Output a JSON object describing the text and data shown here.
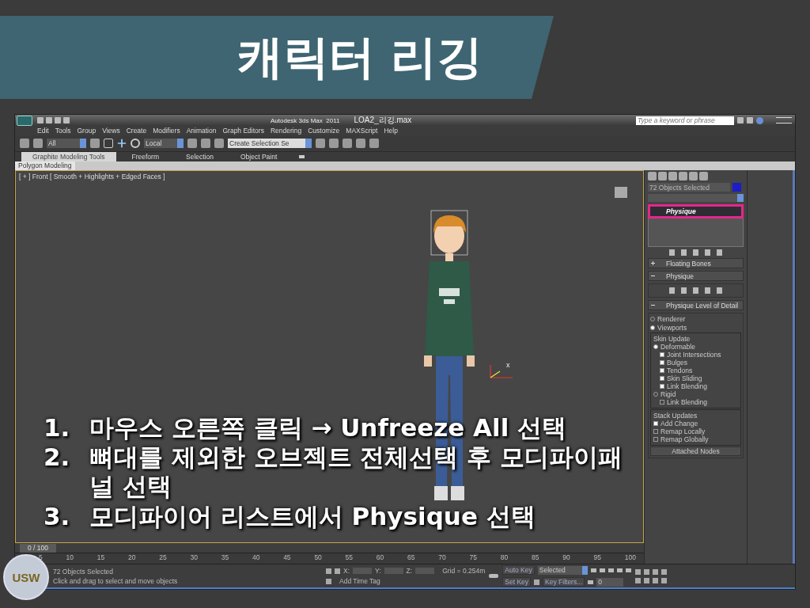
{
  "slide": {
    "title": "캐릭터 리깅"
  },
  "app": {
    "title": "Autodesk 3ds Max  2011",
    "file": "LOA2_리깅.max",
    "search": {
      "placeholder": "Type a keyword or phrase"
    },
    "menu": [
      "Edit",
      "Tools",
      "Group",
      "Views",
      "Create",
      "Modifiers",
      "Animation",
      "Graph Editors",
      "Rendering",
      "Customize",
      "MAXScript",
      "Help"
    ],
    "toolbar": {
      "selection_filter": "All",
      "reference_coordinate": "Local",
      "named_selection": "Create Selection Se"
    },
    "ribbon_tabs": [
      {
        "label": "Graphite Modeling Tools",
        "selected": true
      },
      {
        "label": "Freeform",
        "selected": false
      },
      {
        "label": "Selection",
        "selected": false
      },
      {
        "label": "Object Paint",
        "selected": false
      }
    ],
    "ribbon_panel": "Polygon Modeling",
    "viewport": {
      "label": "[ + ] Front [ Smooth + Highlights + Edged Faces ]",
      "axis_label": "x"
    },
    "command_panel": {
      "object_name": "72 Objects Selected",
      "modifier_stack": [
        {
          "label": "Physique",
          "selected": true,
          "highlighted": true
        }
      ],
      "rollouts": [
        {
          "title": "Floating Bones",
          "expanded": false
        },
        {
          "title": "Physique",
          "expanded": true
        },
        {
          "title": "Physique Level of Detail",
          "expanded": true
        }
      ],
      "modes": [
        {
          "label": "Renderer",
          "selected": false
        },
        {
          "label": "Viewports",
          "selected": true
        }
      ],
      "skin_update": {
        "title": "Skin Update",
        "options": [
          {
            "kind": "radio",
            "label": "Deformable",
            "selected": true
          },
          {
            "kind": "check",
            "label": "Joint Intersections",
            "checked": true
          },
          {
            "kind": "check",
            "label": "Bulges",
            "checked": true
          },
          {
            "kind": "check",
            "label": "Tendons",
            "checked": true
          },
          {
            "kind": "check",
            "label": "Skin Sliding",
            "checked": true
          },
          {
            "kind": "check",
            "label": "Link Blending",
            "checked": true
          },
          {
            "kind": "radio",
            "label": "Rigid",
            "selected": false
          },
          {
            "kind": "check",
            "label": "Link Blending",
            "checked": false
          }
        ]
      },
      "stack_updates": {
        "title": "Stack Updates",
        "options": [
          {
            "label": "Add Change",
            "checked": true
          },
          {
            "label": "Remap Locally",
            "checked": false
          },
          {
            "label": "Remap Globally",
            "checked": false
          }
        ]
      },
      "attached_nodes": "Attached Nodes"
    },
    "timeline": {
      "frame": "0 / 100",
      "level": 0,
      "ticks": [
        "5",
        "10",
        "15",
        "20",
        "25",
        "30",
        "35",
        "40",
        "45",
        "50",
        "55",
        "60",
        "65",
        "70",
        "75",
        "80",
        "85",
        "90",
        "95",
        "100"
      ]
    },
    "status": {
      "selection": "72 Objects Selected",
      "prompt": "Click and drag to select and move objects",
      "x_label": "X:",
      "y_label": "Y:",
      "z_label": "Z:",
      "grid": "Grid = 0.254m",
      "add_time_tag": "Add Time Tag",
      "auto_key": "Auto Key",
      "key_mode": "Selected",
      "set_key": "Set Key",
      "key_filters": "Key Filters...",
      "current_frame": "0"
    }
  },
  "instructions": [
    {
      "number": "1.",
      "text": "마우스 오른쪽 클릭 → Unfreeze All 선택"
    },
    {
      "number": "2.",
      "text": "뼈대를 제외한 오브젝트 전체선택 후 모디파이패널 선택"
    },
    {
      "number": "3.",
      "text": "모디파이어 리스트에서 Physique 선택"
    }
  ],
  "logo": {
    "text": "USW"
  }
}
